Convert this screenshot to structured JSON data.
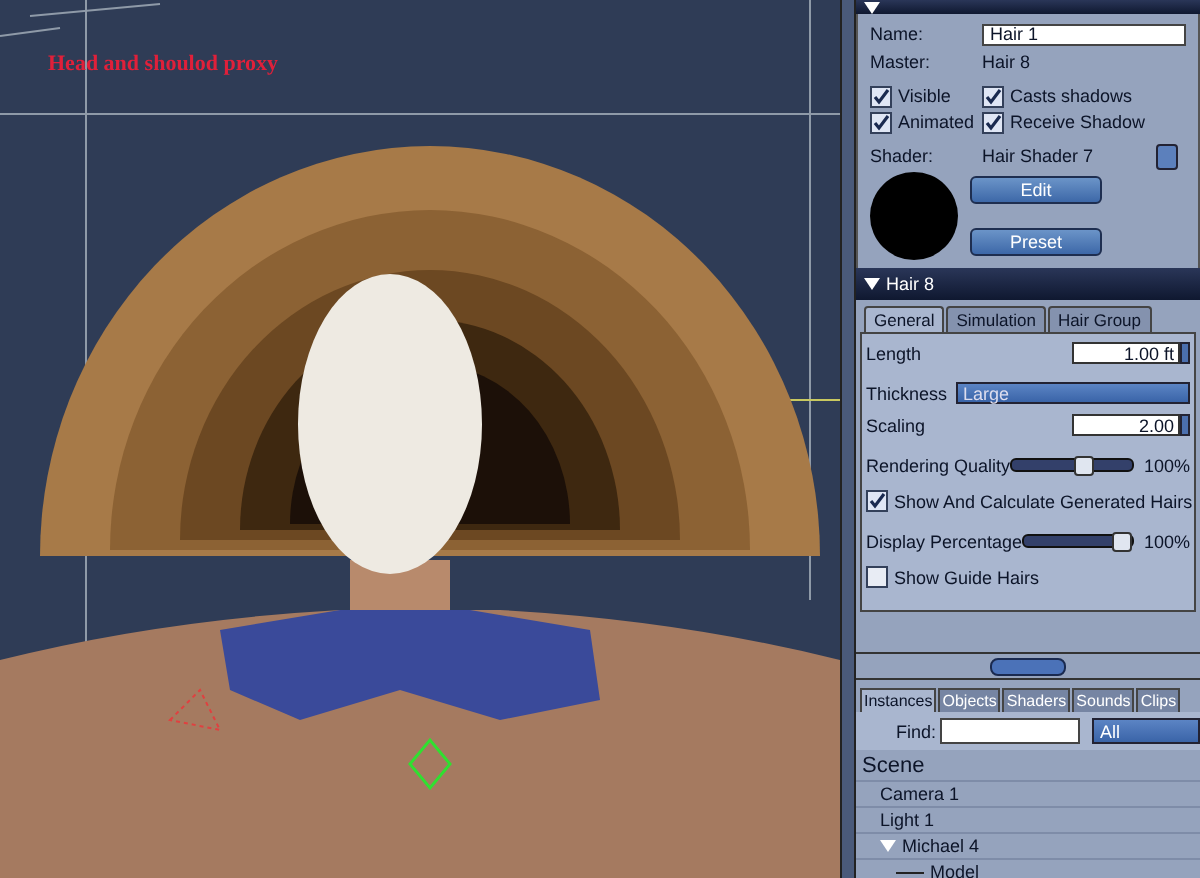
{
  "viewport": {
    "label": "Head and shoulod proxy"
  },
  "general": {
    "expanded": true,
    "name_label": "Name:",
    "name_value": "Hair 1",
    "master_label": "Master:",
    "master_value": "Hair 8",
    "checks": [
      {
        "label": "Visible",
        "checked": true
      },
      {
        "label": "Casts shadows",
        "checked": true
      },
      {
        "label": "Animated",
        "checked": true
      },
      {
        "label": "Receive Shadow",
        "checked": true
      }
    ],
    "shader_label": "Shader:",
    "shader_value": "Hair Shader 7",
    "buttons": [
      "Edit",
      "Preset"
    ]
  },
  "hair": {
    "title": "Hair 8",
    "expanded": true,
    "tabs": [
      {
        "label": "General",
        "selected": true
      },
      {
        "label": "Simulation",
        "selected": false
      },
      {
        "label": "Hair Group",
        "selected": false
      }
    ],
    "rows": [
      {
        "kind": "number",
        "label": "Length",
        "value": "1.00 ft"
      },
      {
        "kind": "dropdown",
        "label": "Thickness",
        "value": "Large"
      },
      {
        "kind": "number",
        "label": "Scaling",
        "value": "2.00"
      },
      {
        "kind": "slider",
        "label": "Rendering Quality",
        "level": 0.6,
        "reading": "100%"
      },
      {
        "kind": "checkbox",
        "label": "Show And Calculate Generated Hairs",
        "checked": true
      },
      {
        "kind": "slider",
        "label": "Display Percentage",
        "level": 0.9,
        "reading": "100%"
      },
      {
        "kind": "checkbox",
        "label": "Show Guide Hairs",
        "checked": false
      }
    ]
  },
  "browser": {
    "tabs": [
      {
        "label": "Instances",
        "selected": true
      },
      {
        "label": "Objects",
        "selected": false
      },
      {
        "label": "Shaders",
        "selected": false
      },
      {
        "label": "Sounds",
        "selected": false
      },
      {
        "label": "Clips",
        "selected": false
      }
    ],
    "find_label": "Find:",
    "filter": "All",
    "tree": [
      {
        "label": "Scene",
        "children": [
          {
            "label": "Camera 1"
          },
          {
            "label": "Light 1"
          },
          {
            "label": "Michael 4",
            "expanded": true,
            "children": [
              {
                "label": "Model"
              }
            ]
          }
        ]
      }
    ]
  }
}
